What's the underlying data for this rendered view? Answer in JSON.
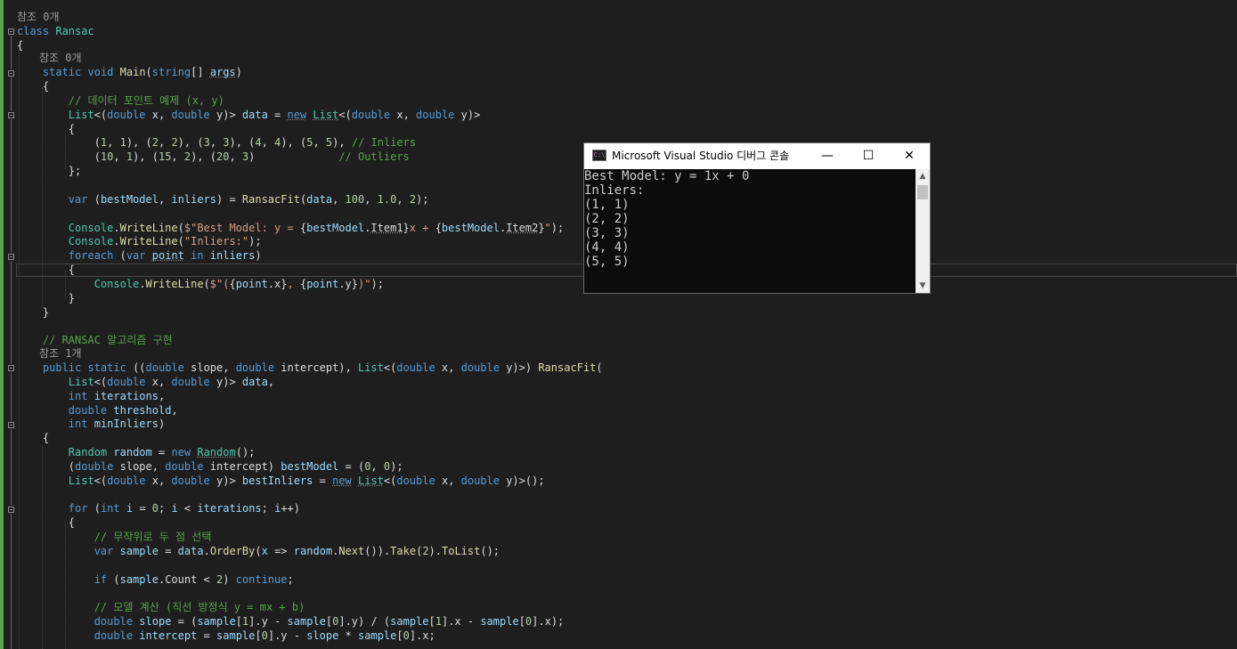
{
  "editor": {
    "code_lens": {
      "class_refs": "참조 0개",
      "main_refs": "참조 0개",
      "ransacfit_refs": "참조 1개"
    }
  },
  "console": {
    "title": "Microsoft Visual Studio 디버그 콘솔",
    "icon_label": "C:\\",
    "minimize": "—",
    "maximize": "☐",
    "close": "✕",
    "output": [
      "Best Model: y = 1x + 0",
      "Inliers:",
      "(1, 1)",
      "(2, 2)",
      "(3, 3)",
      "(4, 4)",
      "(5, 5)"
    ]
  }
}
